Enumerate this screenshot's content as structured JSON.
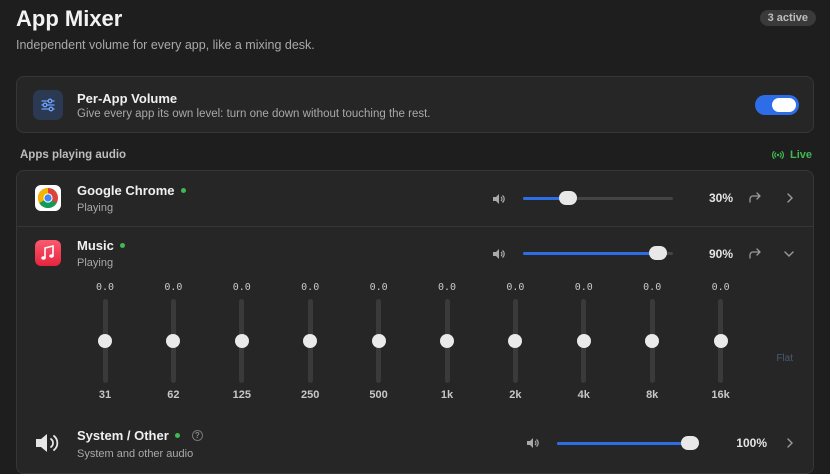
{
  "header": {
    "title": "App Mixer",
    "subtitle": "Independent volume for every app, like a mixing desk.",
    "badge": "3 active"
  },
  "feature": {
    "icon": "sliders-icon",
    "title": "Per-App Volume",
    "description": "Give every app its own level: turn one down without touching the rest.",
    "enabled": true
  },
  "section": {
    "label": "Apps playing audio",
    "live_label": "Live"
  },
  "apps": [
    {
      "name": "Google Chrome",
      "status": "Playing",
      "volume_pct": 30,
      "volume_label": "30%",
      "icon": "chrome-icon"
    },
    {
      "name": "Music",
      "status": "Playing",
      "volume_pct": 90,
      "volume_label": "90%",
      "icon": "music-icon",
      "expanded": true
    },
    {
      "name": "System / Other",
      "status": "System and other audio",
      "volume_pct": 100,
      "volume_label": "100%",
      "icon": "speaker-icon"
    }
  ],
  "equalizer": {
    "bands": [
      {
        "label": "31",
        "value": "0.0"
      },
      {
        "label": "62",
        "value": "0.0"
      },
      {
        "label": "125",
        "value": "0.0"
      },
      {
        "label": "250",
        "value": "0.0"
      },
      {
        "label": "500",
        "value": "0.0"
      },
      {
        "label": "1k",
        "value": "0.0"
      },
      {
        "label": "2k",
        "value": "0.0"
      },
      {
        "label": "4k",
        "value": "0.0"
      },
      {
        "label": "8k",
        "value": "0.0"
      },
      {
        "label": "16k",
        "value": "0.0"
      }
    ],
    "flat_label": "Flat"
  },
  "colors": {
    "accent": "#2e6de8",
    "live": "#3fb950",
    "background": "#1e1e1e"
  }
}
